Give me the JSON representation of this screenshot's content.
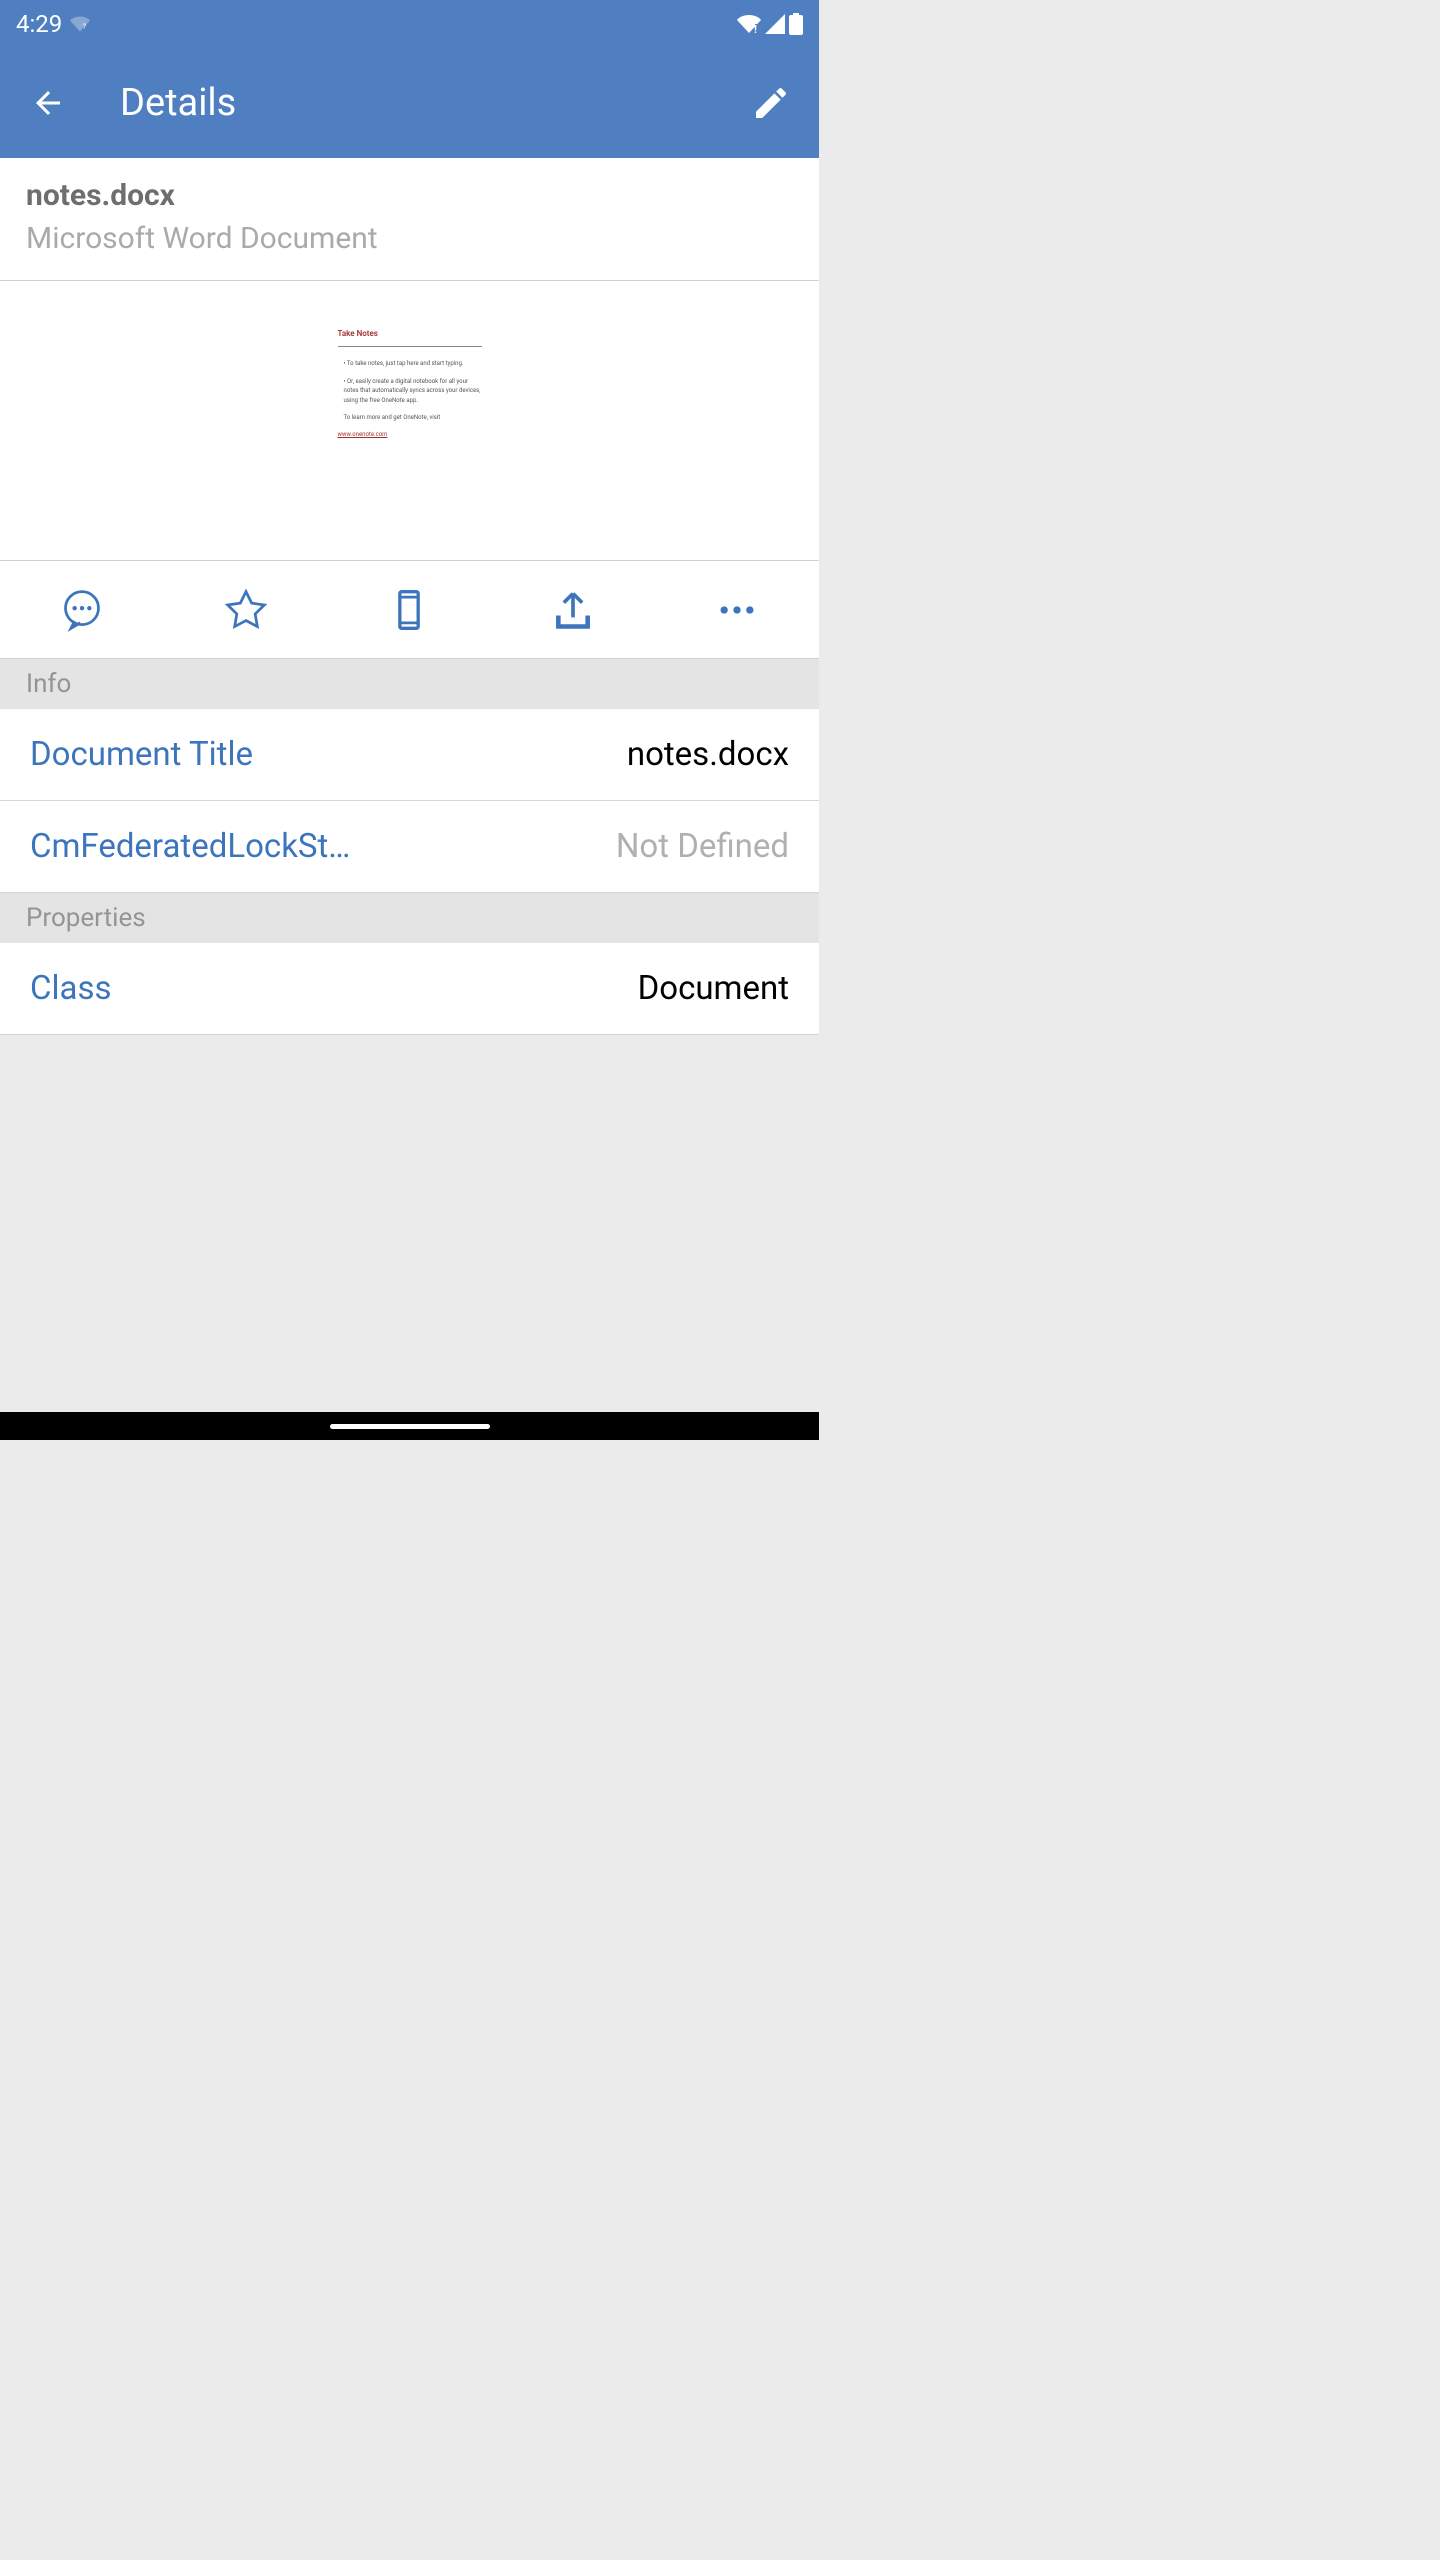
{
  "status": {
    "time": "4:29"
  },
  "appBar": {
    "title": "Details"
  },
  "file": {
    "name": "notes.docx",
    "type": "Microsoft Word Document"
  },
  "preview": {
    "docTitle": "Take Notes",
    "bullet1": "• To take notes, just tap here and start typing.",
    "bullet2": "• Or, easily create a digital notebook for all your notes that automatically syncs across your devices, using the free OneNote app.",
    "footer": "To learn more and get OneNote, visit",
    "link": "www.onenote.com"
  },
  "sections": {
    "info": {
      "header": "Info",
      "rows": [
        {
          "label": "Document Title",
          "value": "notes.docx"
        },
        {
          "label": "CmFederatedLockSt…",
          "value": "Not Defined"
        }
      ]
    },
    "properties": {
      "header": "Properties",
      "rows": [
        {
          "label": "Class",
          "value": "Document"
        }
      ]
    }
  }
}
